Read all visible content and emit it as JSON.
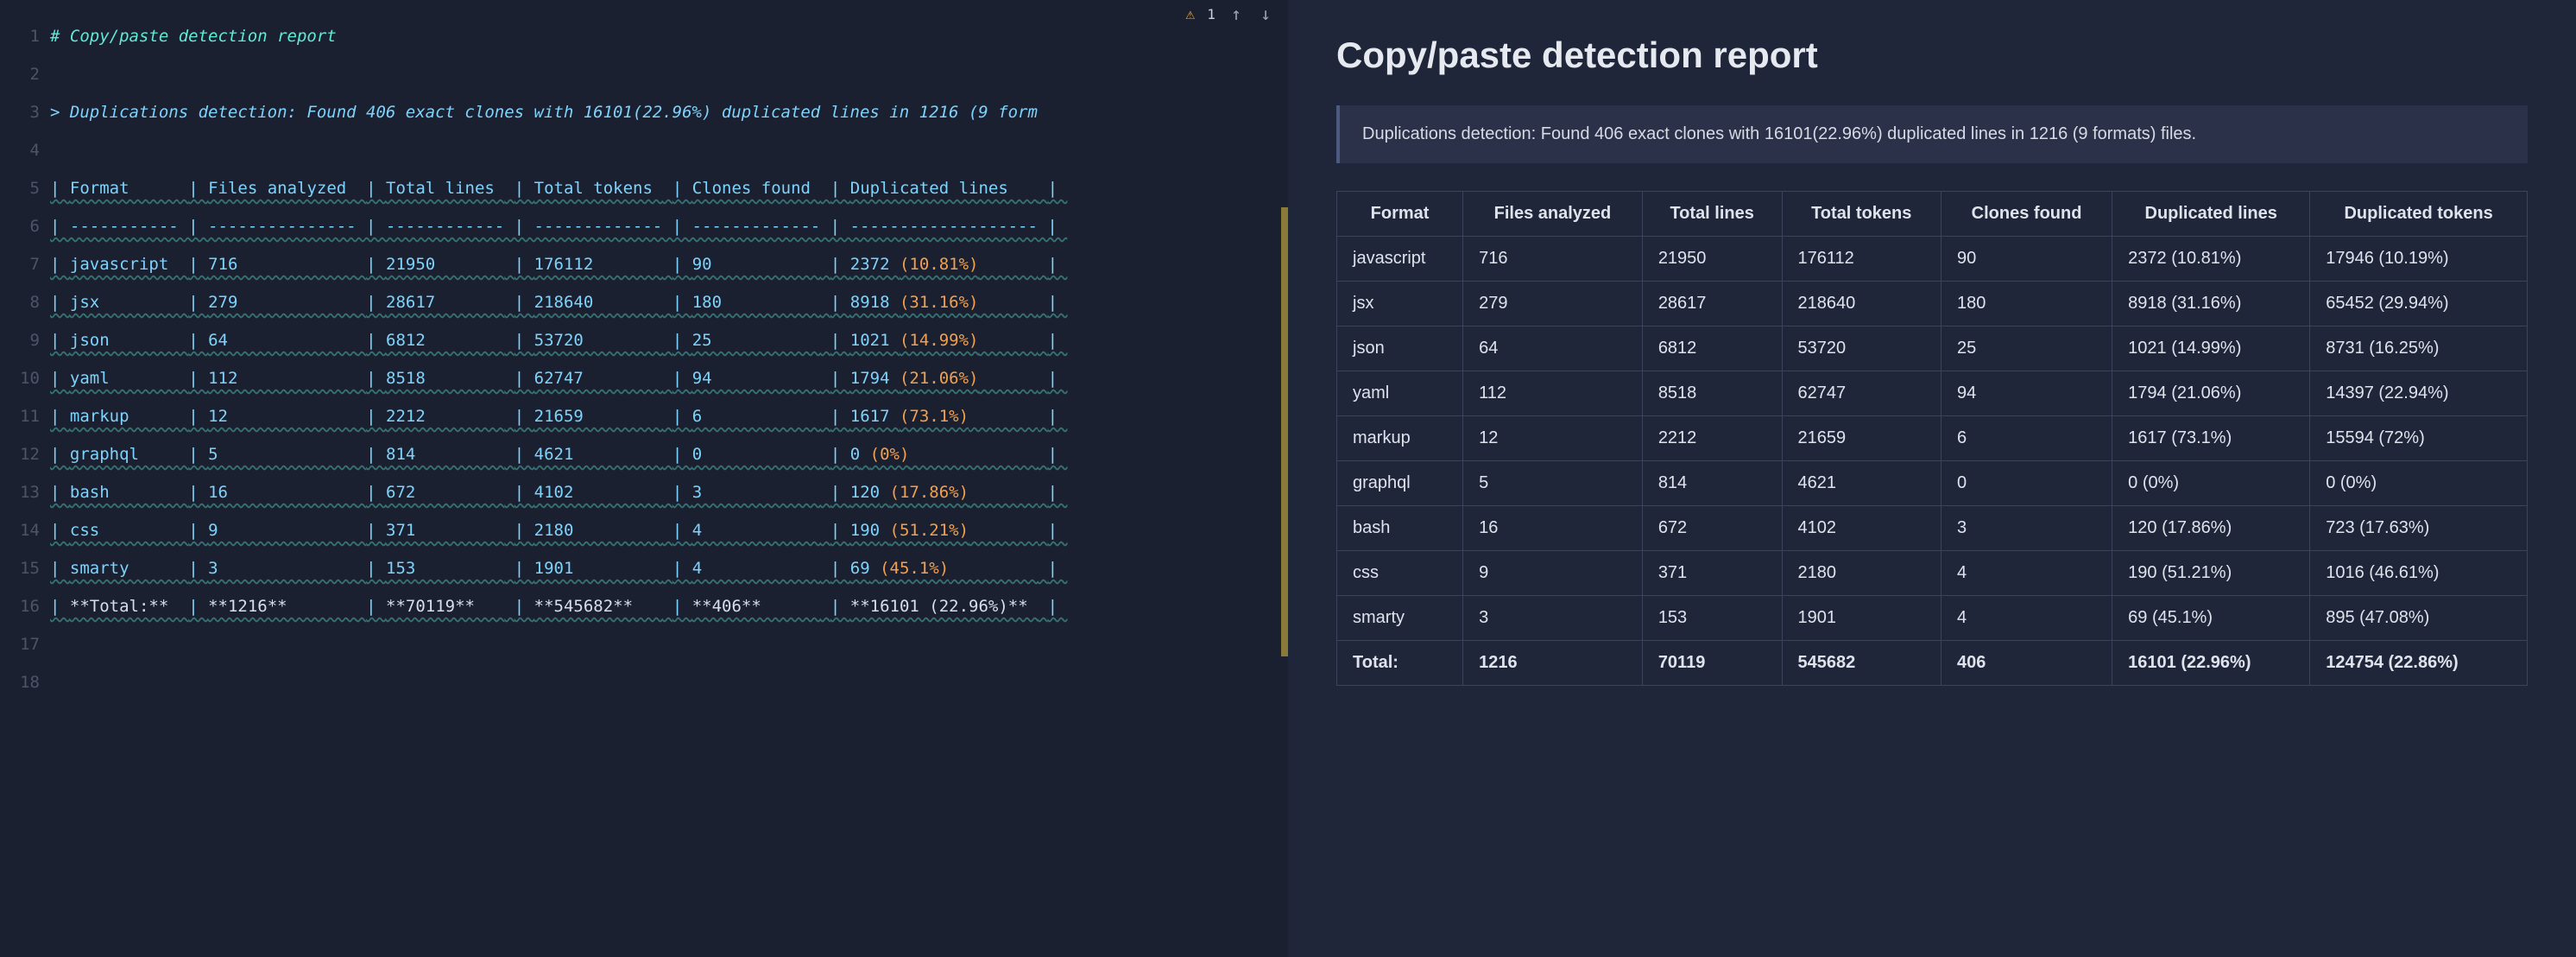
{
  "title": "Copy/paste detection report",
  "summary": "Duplications detection: Found 406 exact clones with 16101(22.96%) duplicated lines in 1216 (9 formats) files.",
  "editor": {
    "comment_line": "# Copy/paste detection report",
    "quote_line_prefix": "> ",
    "quote_line": "Duplications detection: Found 406 exact clones with 16101(22.96%) duplicated lines in 1216 (9 form",
    "warning_count": "1",
    "gutter_start": 1,
    "gutter_lines": 18
  },
  "columns_source": [
    "Format",
    "Files analyzed",
    "Total lines",
    "Total tokens",
    "Clones found",
    "Duplicated lines"
  ],
  "columns": [
    "Format",
    "Files analyzed",
    "Total lines",
    "Total tokens",
    "Clones found",
    "Duplicated lines",
    "Duplicated tokens"
  ],
  "rows": [
    {
      "format": "javascript",
      "files": "716",
      "lines": "21950",
      "tokens": "176112",
      "clones": "90",
      "dup_lines": "2372 (10.81%)",
      "dup_tokens": "17946 (10.19%)"
    },
    {
      "format": "jsx",
      "files": "279",
      "lines": "28617",
      "tokens": "218640",
      "clones": "180",
      "dup_lines": "8918 (31.16%)",
      "dup_tokens": "65452 (29.94%)"
    },
    {
      "format": "json",
      "files": "64",
      "lines": "6812",
      "tokens": "53720",
      "clones": "25",
      "dup_lines": "1021 (14.99%)",
      "dup_tokens": "8731 (16.25%)"
    },
    {
      "format": "yaml",
      "files": "112",
      "lines": "8518",
      "tokens": "62747",
      "clones": "94",
      "dup_lines": "1794 (21.06%)",
      "dup_tokens": "14397 (22.94%)"
    },
    {
      "format": "markup",
      "files": "12",
      "lines": "2212",
      "tokens": "21659",
      "clones": "6",
      "dup_lines": "1617 (73.1%)",
      "dup_tokens": "15594 (72%)"
    },
    {
      "format": "graphql",
      "files": "5",
      "lines": "814",
      "tokens": "4621",
      "clones": "0",
      "dup_lines": "0 (0%)",
      "dup_tokens": "0 (0%)"
    },
    {
      "format": "bash",
      "files": "16",
      "lines": "672",
      "tokens": "4102",
      "clones": "3",
      "dup_lines": "120 (17.86%)",
      "dup_tokens": "723 (17.63%)"
    },
    {
      "format": "css",
      "files": "9",
      "lines": "371",
      "tokens": "2180",
      "clones": "4",
      "dup_lines": "190 (51.21%)",
      "dup_tokens": "1016 (46.61%)"
    },
    {
      "format": "smarty",
      "files": "3",
      "lines": "153",
      "tokens": "1901",
      "clones": "4",
      "dup_lines": "69 (45.1%)",
      "dup_tokens": "895 (47.08%)"
    }
  ],
  "total": {
    "label": "Total:",
    "files": "1216",
    "lines": "70119",
    "tokens": "545682",
    "clones": "406",
    "dup_lines": "16101 (22.96%)",
    "dup_tokens": "124754 (22.86%)"
  },
  "source_total": {
    "label": "**Total:**",
    "files": "**1216**",
    "lines": "**70119**",
    "tokens": "**545682**",
    "clones": "**406**",
    "dup_lines": "**16101 (22.96%)**"
  }
}
